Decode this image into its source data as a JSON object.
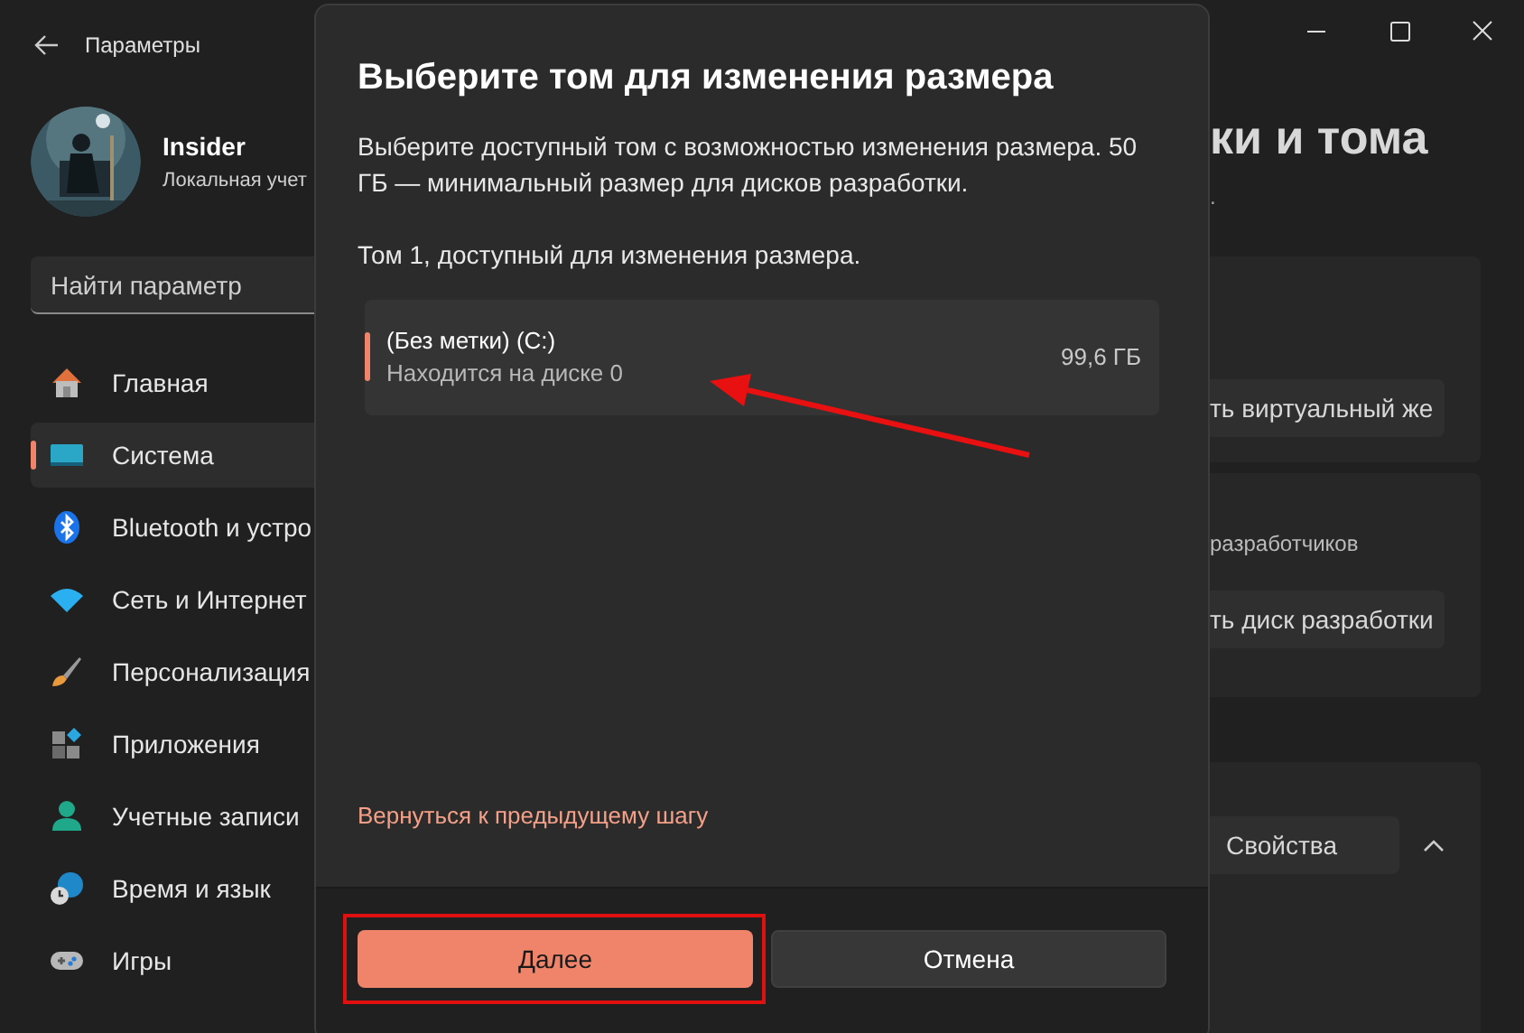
{
  "window": {
    "title": "Параметры"
  },
  "user": {
    "name": "Insider",
    "account": "Локальная учет"
  },
  "search": {
    "placeholder": "Найти параметр"
  },
  "nav": [
    {
      "label": "Главная",
      "selected": false
    },
    {
      "label": "Система",
      "selected": true
    },
    {
      "label": "Bluetooth и устро",
      "selected": false
    },
    {
      "label": "Сеть и Интернет",
      "selected": false
    },
    {
      "label": "Персонализация",
      "selected": false
    },
    {
      "label": "Приложения",
      "selected": false
    },
    {
      "label": "Учетные записи",
      "selected": false
    },
    {
      "label": "Время и язык",
      "selected": false
    },
    {
      "label": "Игры",
      "selected": false
    }
  ],
  "page": {
    "title": "ки и тома",
    "subtitle": ".",
    "virtual_disk_button": "ть виртуальный же",
    "dev_drive_text": "разработчиков",
    "dev_drive_button": "ть диск разработки",
    "properties_button": "Свойства"
  },
  "dialog": {
    "title": "Выберите том для изменения размера",
    "description": "Выберите доступный том с возможностью изменения размера. 50 ГБ — минимальный размер для дисков разработки.",
    "list_label": "Том 1, доступный для изменения размера.",
    "volumes": [
      {
        "name": "(Без метки) (C:)",
        "location": "Находится на диске 0",
        "size": "99,6 ГБ",
        "selected": true
      }
    ],
    "back_link": "Вернуться к предыдущему шагу",
    "buttons": [
      {
        "label": "Далее",
        "kind": "primary"
      },
      {
        "label": "Отмена",
        "kind": "secondary"
      }
    ]
  }
}
